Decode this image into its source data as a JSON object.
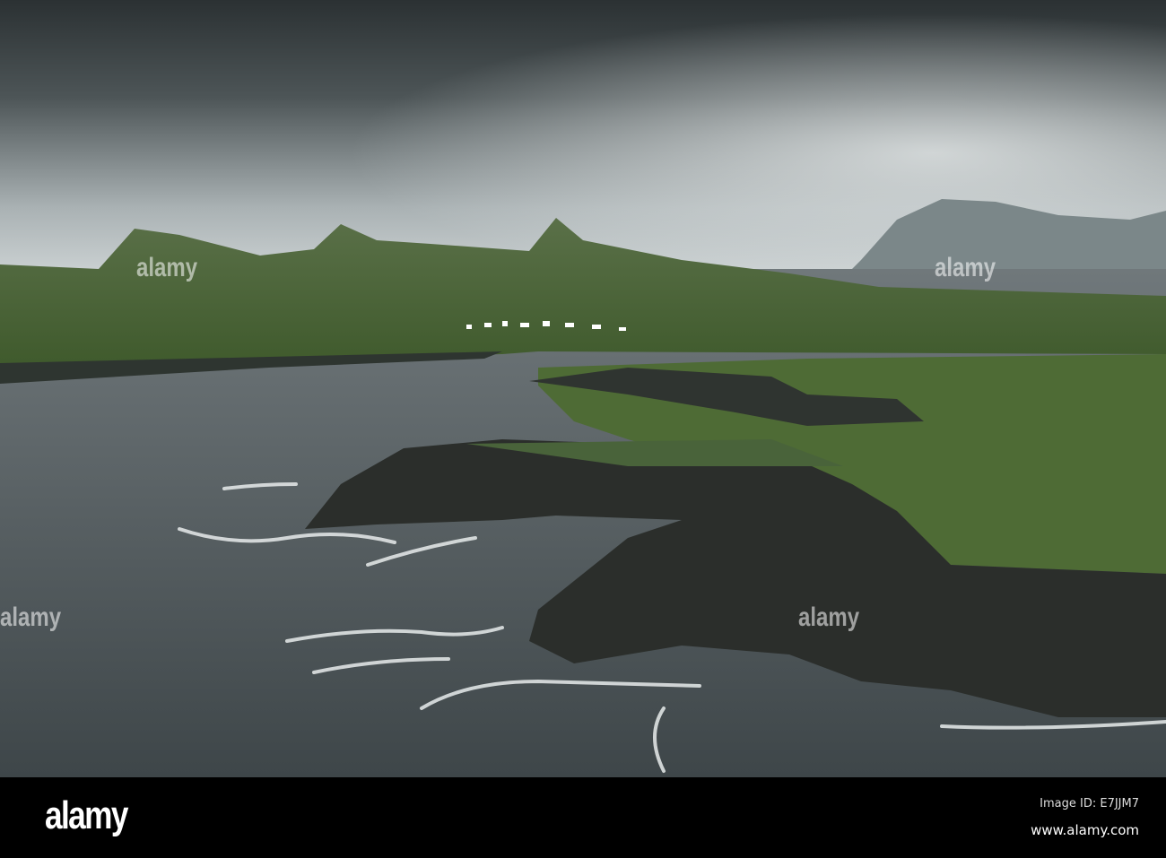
{
  "watermark": {
    "text": "alamy"
  },
  "footer": {
    "logo": "alamy",
    "image_id": "Image ID: E7JJM7",
    "url": "www.alamy.com"
  },
  "colors": {
    "sky_dark": "#2f3537",
    "sky_light": "#c9cfd0",
    "sea": "#4a5256",
    "land": "#4f6b3a",
    "rock": "#2a2d2a"
  }
}
